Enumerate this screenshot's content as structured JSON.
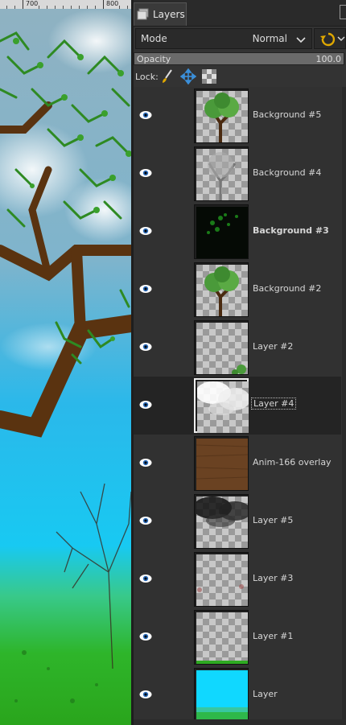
{
  "ruler": {
    "labels": [
      "700",
      "800"
    ]
  },
  "dock": {
    "tab_label": "Layers",
    "mode_label": "Mode",
    "mode_value": "Normal",
    "opacity_label": "Opacity",
    "opacity_value": "100.0",
    "opacity_fraction": 1.0,
    "lock_label": "Lock:"
  },
  "layers": [
    {
      "name": "Background #5",
      "thumb": "tree-green",
      "visible": true
    },
    {
      "name": "Background #4",
      "thumb": "tree-gray",
      "visible": true
    },
    {
      "name": "Background #3",
      "thumb": "dark-green-leaves",
      "visible": true,
      "bold": true
    },
    {
      "name": "Background #2",
      "thumb": "tree-green",
      "visible": true
    },
    {
      "name": "Layer #2",
      "thumb": "checker-corner-green",
      "visible": true
    },
    {
      "name": "Layer #4",
      "thumb": "clouds-white",
      "visible": true,
      "active": true
    },
    {
      "name": "Anim-166 overlay",
      "thumb": "brown-texture",
      "visible": true
    },
    {
      "name": "Layer #5",
      "thumb": "clouds-dark",
      "visible": true
    },
    {
      "name": "Layer #3",
      "thumb": "checker-faint-red",
      "visible": true
    },
    {
      "name": "Layer #1",
      "thumb": "checker-green-strip",
      "visible": true
    },
    {
      "name": "Layer",
      "thumb": "cyan-sky-grass",
      "visible": true
    }
  ],
  "colors": {
    "panel_bg": "#333333",
    "active_row": "#242424",
    "eye": "#ffffff",
    "accent_blue": "#3b8fd9"
  },
  "icons": [
    "layers-tab-icon",
    "chevron-down-icon",
    "reset-icon",
    "paint-brush-icon",
    "move-arrows-icon",
    "alpha-checker-icon",
    "eye-icon"
  ]
}
